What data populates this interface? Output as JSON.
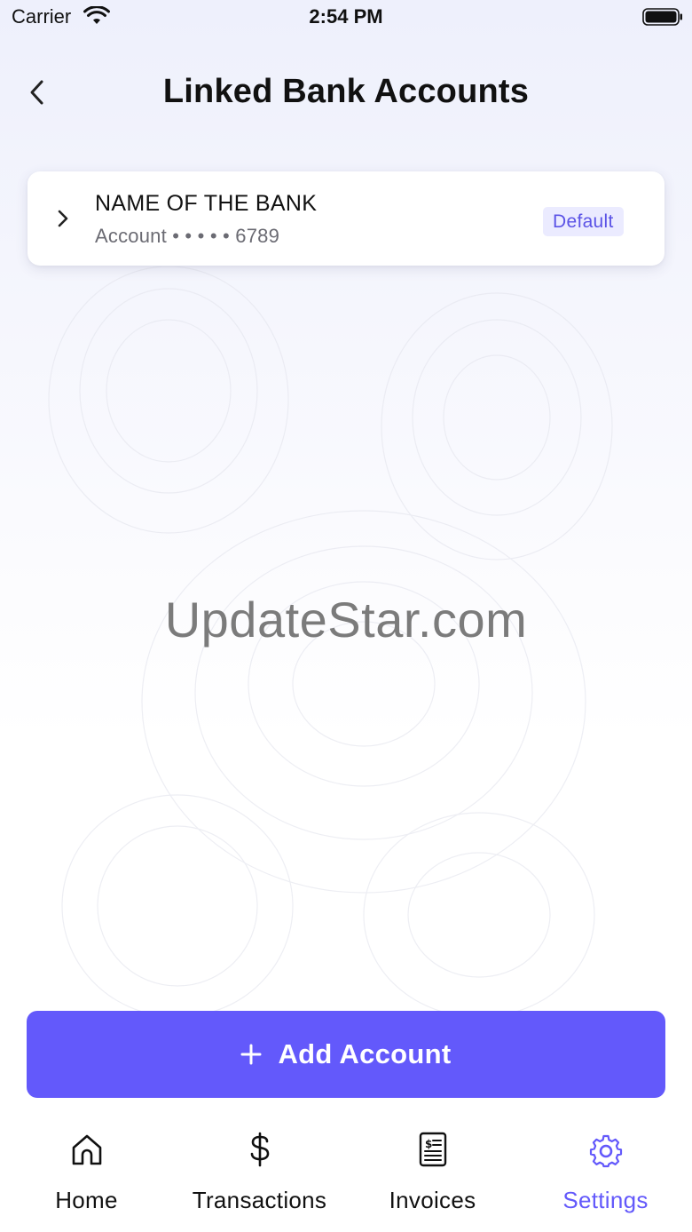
{
  "status_bar": {
    "carrier": "Carrier",
    "time": "2:54 PM"
  },
  "header": {
    "title": "Linked Bank Accounts",
    "back_icon": "chevron-left-icon"
  },
  "accounts": [
    {
      "bank_name": "NAME OF THE BANK",
      "account_label": "Account • • • • • 6789",
      "badge": "Default"
    }
  ],
  "watermark": "UpdateStar.com",
  "add_button": {
    "label": "Add Account",
    "icon": "plus-icon"
  },
  "tab_bar": {
    "tabs": [
      {
        "label": "Home",
        "icon": "home-icon",
        "active": false
      },
      {
        "label": "Transactions",
        "icon": "dollar-icon",
        "active": false
      },
      {
        "label": "Invoices",
        "icon": "invoice-icon",
        "active": false
      },
      {
        "label": "Settings",
        "icon": "gear-icon",
        "active": true
      }
    ]
  },
  "colors": {
    "accent": "#6359fb",
    "badge_bg": "#ebebff",
    "badge_text": "#5b53e6",
    "secondary_text": "#6b6b73"
  }
}
